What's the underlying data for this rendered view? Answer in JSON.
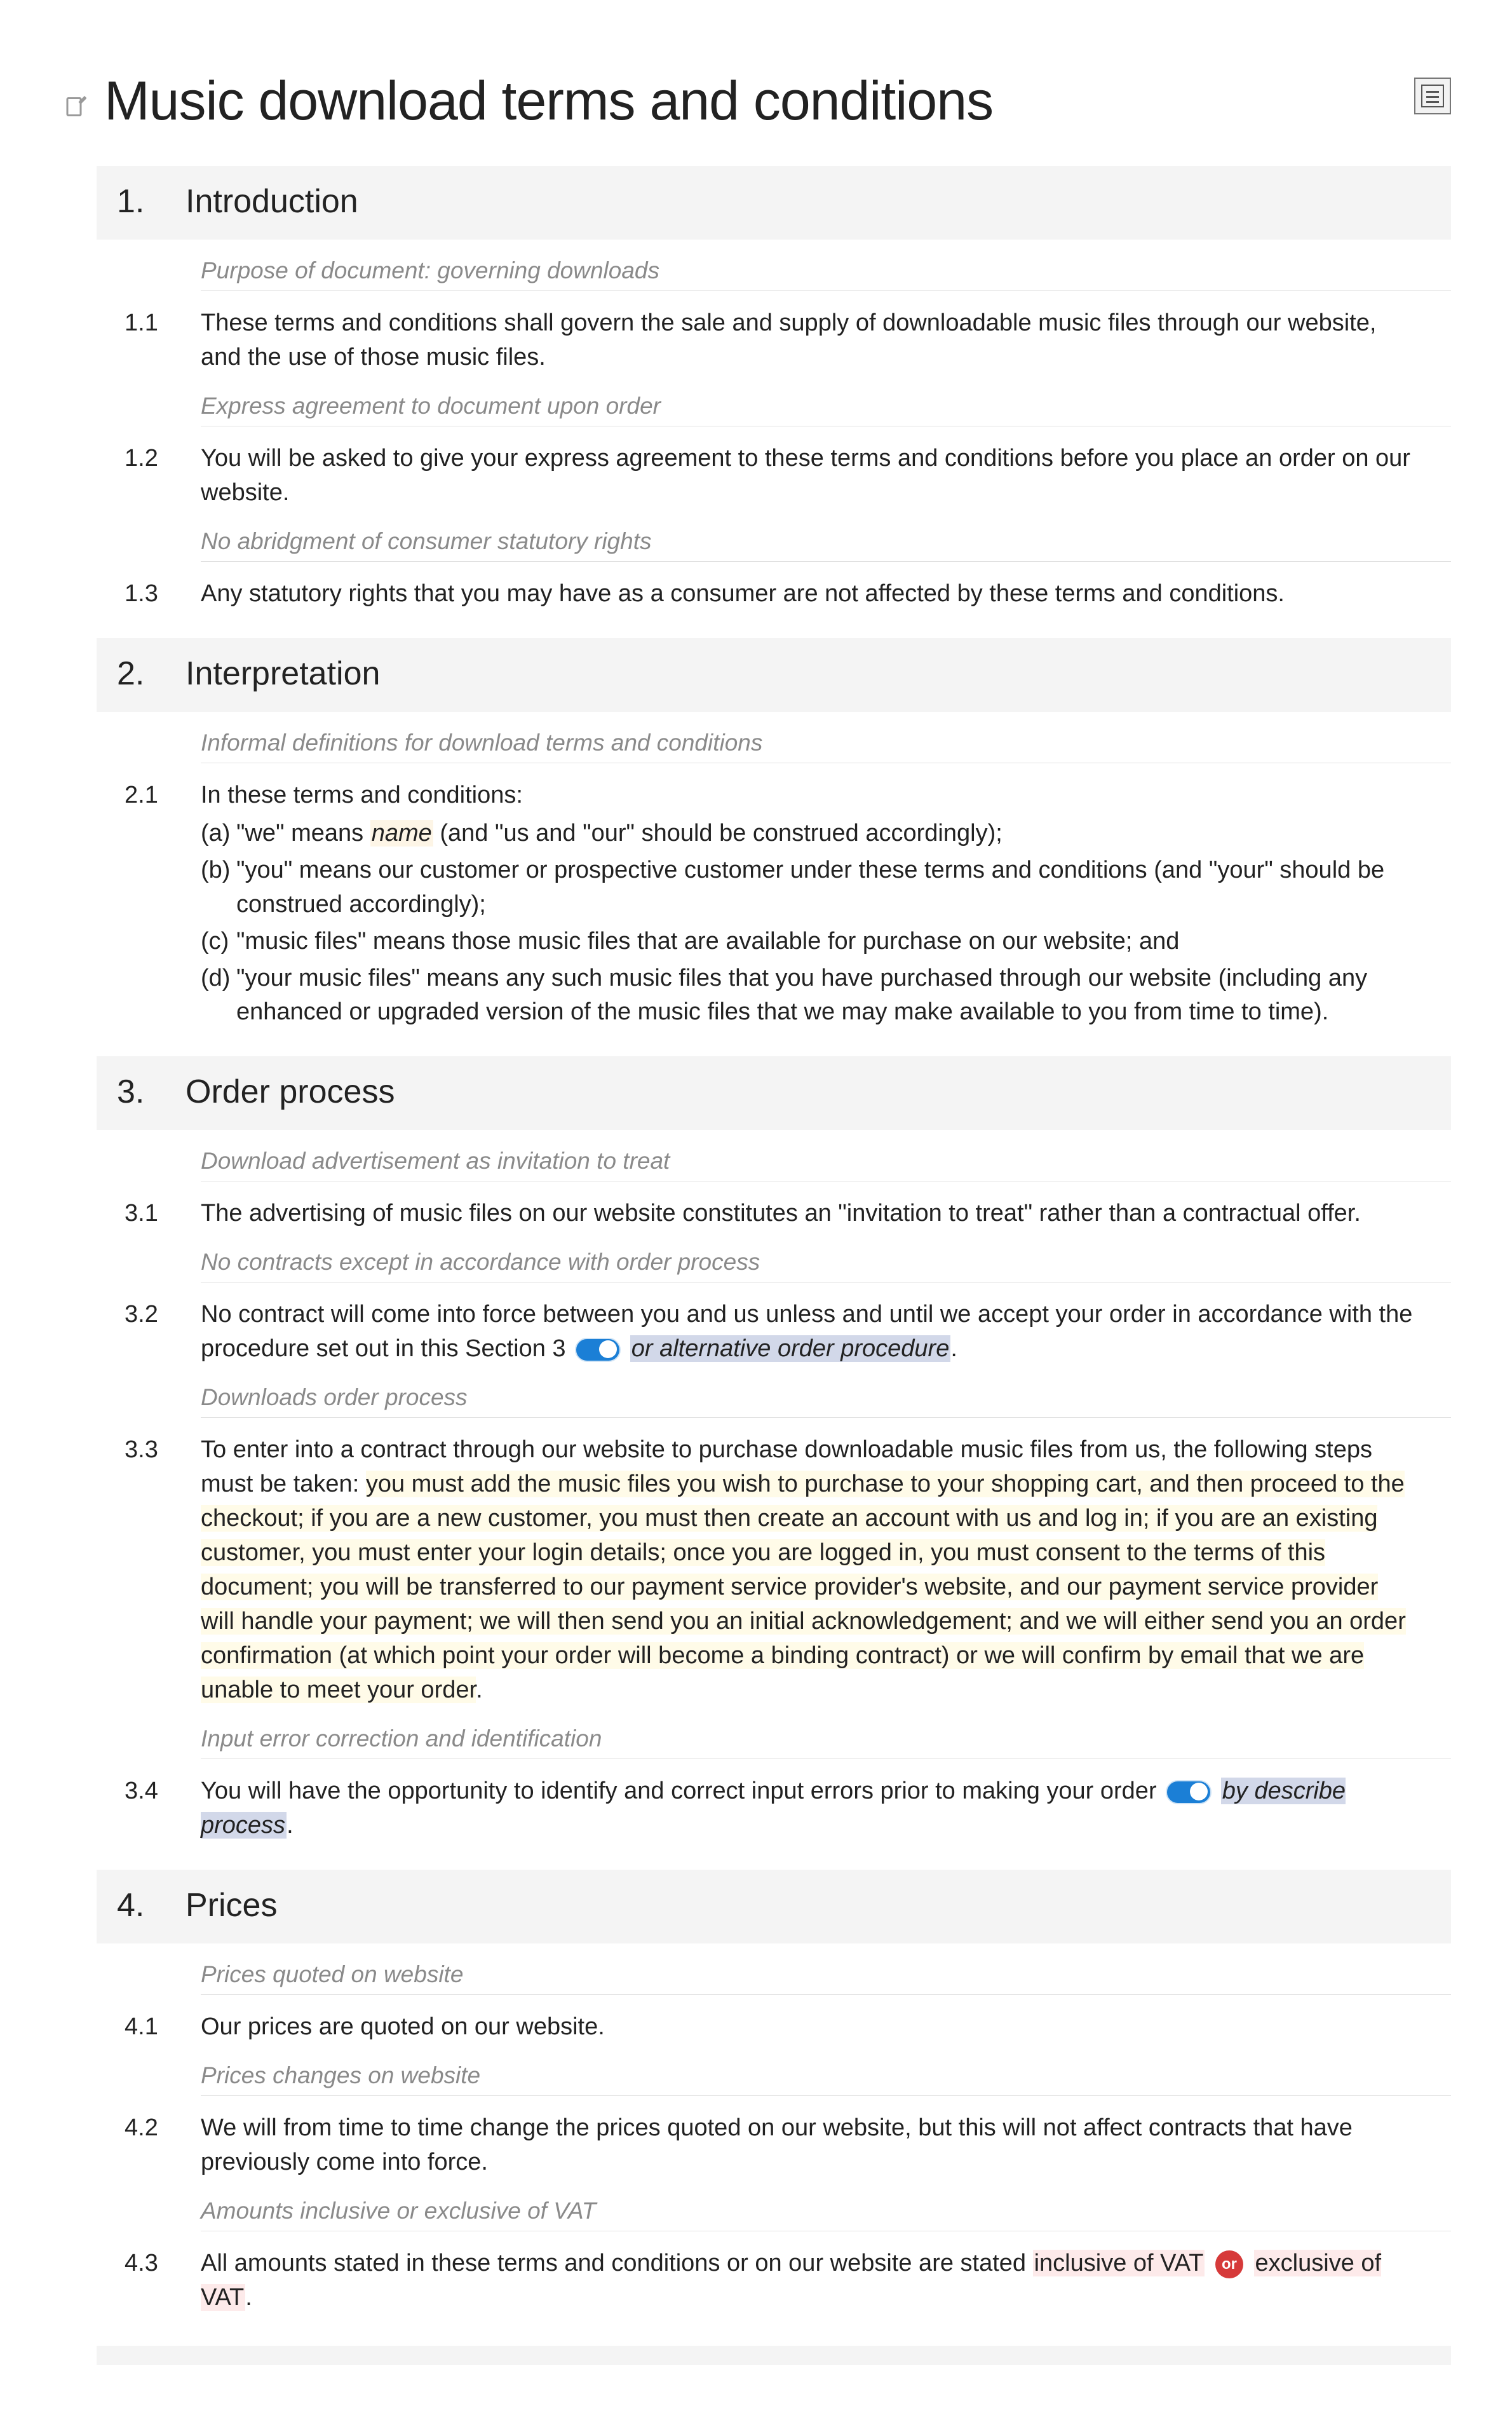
{
  "doc": {
    "title": "Music download terms and conditions"
  },
  "sections": {
    "s1": {
      "num": "1.",
      "title": "Introduction"
    },
    "s2": {
      "num": "2.",
      "title": "Interpretation"
    },
    "s3": {
      "num": "3.",
      "title": "Order process"
    },
    "s4": {
      "num": "4.",
      "title": "Prices"
    }
  },
  "subtitles": {
    "s1a": "Purpose of document: governing downloads",
    "s1b": "Express agreement to document upon order",
    "s1c": "No abridgment of consumer statutory rights",
    "s2a": "Informal definitions for download terms and conditions",
    "s3a": "Download advertisement as invitation to treat",
    "s3b": "No contracts except in accordance with order process",
    "s3c": "Downloads order process",
    "s3d": "Input error correction and identification",
    "s4a": "Prices quoted on website",
    "s4b": "Prices changes on website",
    "s4c": "Amounts inclusive or exclusive of VAT"
  },
  "clauses": {
    "c11": {
      "num": "1.1",
      "text": "These terms and conditions shall govern the sale and supply of downloadable music files through our website, and the use of those music files."
    },
    "c12": {
      "num": "1.2",
      "text": "You will be asked to give your express agreement to these terms and conditions before you place an order on our website."
    },
    "c13": {
      "num": "1.3",
      "text": "Any statutory rights that you may have as a consumer are not affected by these terms and conditions."
    },
    "c21": {
      "num": "2.1",
      "intro": "In these terms and conditions:"
    },
    "c31": {
      "num": "3.1",
      "text": "The advertising of music files on our website constitutes an \"invitation to treat\" rather than a contractual offer."
    },
    "c32": {
      "num": "3.2",
      "pre": "No contract will come into force between you and us unless and until we accept your order in accordance with the procedure set out in this Section 3",
      "or_word": " or ",
      "alt": "alternative order procedure",
      "post": "."
    },
    "c33": {
      "num": "3.3",
      "pre": "To enter into a contract through our website to purchase downloadable music files from us, the following steps must be taken: ",
      "hl": "you must add the music files you wish to purchase to your shopping cart, and then proceed to the checkout; if you are a new customer, you must then create an account with us and log in; if you are an existing customer, you must enter your login details; once you are logged in, you must consent to the terms of this document; you will be transferred to our payment service provider's website, and our payment service provider will handle your payment; we will then send you an initial acknowledgement; and we will either send you an order confirmation (at which point your order will become a binding contract) or we will confirm by email that we are unable to meet your order",
      "post": "."
    },
    "c34": {
      "num": "3.4",
      "pre": "You will have the opportunity to identify and correct input errors prior to making your order",
      "by": " by ",
      "desc": "describe process",
      "post": "."
    },
    "c41": {
      "num": "4.1",
      "text": "Our prices are quoted on our website."
    },
    "c42": {
      "num": "4.2",
      "text": "We will from time to time change the prices quoted on our website, but this will not affect contracts that have previously come into force."
    },
    "c43": {
      "num": "4.3",
      "pre": "All amounts stated in these terms and conditions or on our website are stated ",
      "opt1": "inclusive of VAT",
      "or_label": "or",
      "opt2": "exclusive of VAT",
      "post": "."
    }
  },
  "defs": {
    "a": {
      "marker": "(a)",
      "pre": "\"we\" means ",
      "name": "name",
      "post": " (and \"us and \"our\" should be construed accordingly);"
    },
    "b": {
      "marker": "(b)",
      "text": "\"you\" means our customer or prospective customer under these terms and conditions (and \"your\" should be construed accordingly);"
    },
    "c": {
      "marker": "(c)",
      "text": "\"music files\" means those music files that are available for purchase on our website; and"
    },
    "d": {
      "marker": "(d)",
      "text": "\"your music files\" means any such music files that you have purchased through our website (including any enhanced or upgraded version of the music files that we may make available to you from time to time)."
    }
  }
}
